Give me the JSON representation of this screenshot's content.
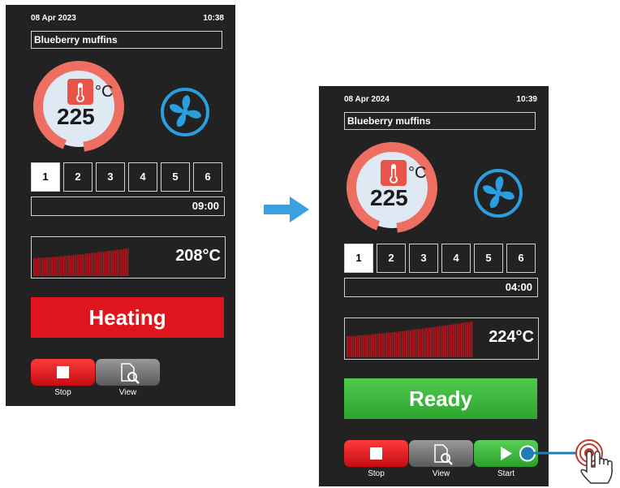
{
  "screens": [
    {
      "date": "08 Apr 2023",
      "time": "10:38",
      "recipe": "Blueberry muffins",
      "unit": "°C",
      "set_temp": "225",
      "steps": [
        "1",
        "2",
        "3",
        "4",
        "5",
        "6"
      ],
      "active_step": "1",
      "timer": "09:00",
      "current_temp": "208°C",
      "status": "Heating",
      "buttons": {
        "stop": "Stop",
        "view": "View"
      }
    },
    {
      "date": "08 Apr 2024",
      "time": "10:39",
      "recipe": "Blueberry muffins",
      "unit": "°C",
      "set_temp": "225",
      "steps": [
        "1",
        "2",
        "3",
        "4",
        "5",
        "6"
      ],
      "active_step": "1",
      "timer": "04:00",
      "current_temp": "224°C",
      "status": "Ready",
      "buttons": {
        "stop": "Stop",
        "view": "View",
        "start": "Start"
      }
    }
  ],
  "icons": {
    "transition": "arrow-right-icon",
    "touch": "hand-pointer-icon",
    "thermometer": "thermometer-icon",
    "fan": "fan-icon"
  },
  "colors": {
    "heating": "#e0141c",
    "ready": "#2ea52e",
    "fan": "#2a9fe0",
    "arrow": "#3aa0e0",
    "graph": "#b0141c"
  }
}
